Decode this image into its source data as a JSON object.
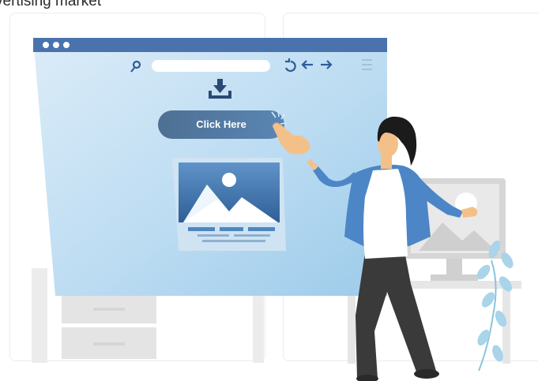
{
  "header": {
    "partial_title": "vertising market"
  },
  "browser": {
    "button_label": "Click Here",
    "icons": [
      "window-dots-icon",
      "search-icon",
      "refresh-icon",
      "back-arrow-icon",
      "forward-arrow-icon",
      "menu-icon",
      "download-icon",
      "image-icon"
    ]
  },
  "colors": {
    "window_frame": "#4a73ad",
    "screen_light": "#dcecf8",
    "screen_dark": "#9ccbea",
    "button": "#4e6f93",
    "hand": "#f4c089",
    "hair": "#1b1b1b",
    "cardigan": "#4d86c6",
    "trousers": "#3a3a3a",
    "desk": "#e8e8e8",
    "plant": "#a9d4ea"
  }
}
